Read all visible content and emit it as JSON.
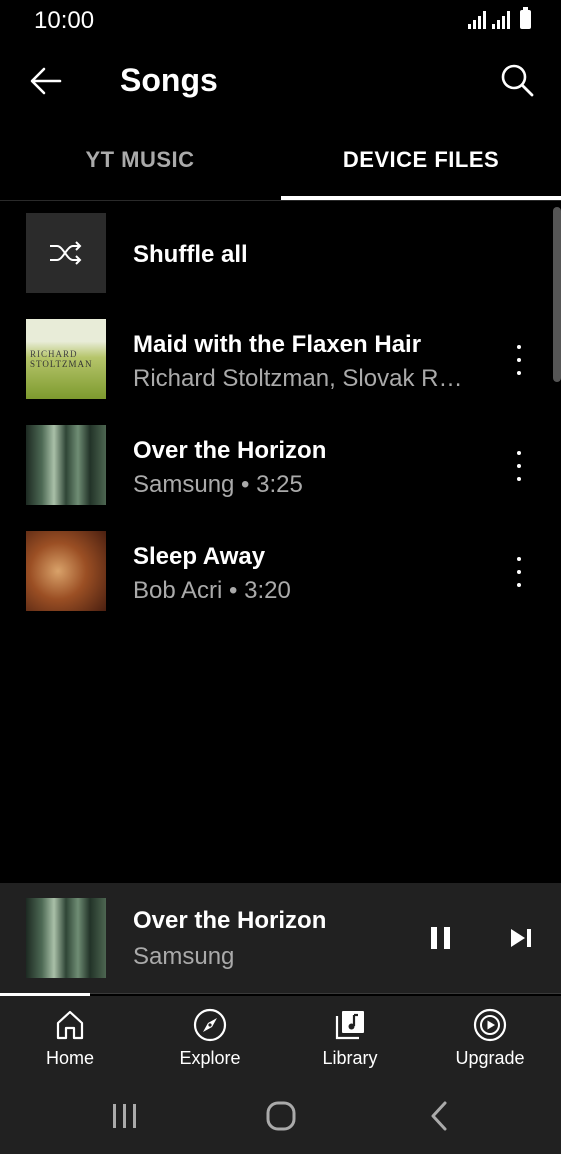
{
  "status_bar": {
    "time": "10:00"
  },
  "header": {
    "title": "Songs",
    "back_icon": "arrow-left-icon",
    "search_icon": "search-icon"
  },
  "tabs": [
    {
      "label": "YT MUSIC",
      "selected": false
    },
    {
      "label": "DEVICE FILES",
      "selected": true
    }
  ],
  "list": {
    "shuffle": {
      "label": "Shuffle all",
      "icon": "shuffle-icon"
    },
    "songs": [
      {
        "title": "Maid with the Flaxen Hair",
        "subtitle": "Richard Stoltzman, Slovak R…",
        "thumb_text_1": "RICHARD",
        "thumb_text_2": "STOLTZMAN"
      },
      {
        "title": "Over the Horizon",
        "subtitle": "Samsung • 3:25"
      },
      {
        "title": "Sleep Away",
        "subtitle": "Bob Acri • 3:20"
      }
    ]
  },
  "mini_player": {
    "title": "Over the Horizon",
    "artist": "Samsung",
    "progress": 0.16
  },
  "bottom_nav": [
    {
      "label": "Home",
      "icon": "home-icon"
    },
    {
      "label": "Explore",
      "icon": "compass-icon"
    },
    {
      "label": "Library",
      "icon": "library-icon"
    },
    {
      "label": "Upgrade",
      "icon": "upgrade-icon"
    }
  ],
  "colors": {
    "background": "#000000",
    "surface": "#212121",
    "secondary_text": "#aaaaaa"
  }
}
